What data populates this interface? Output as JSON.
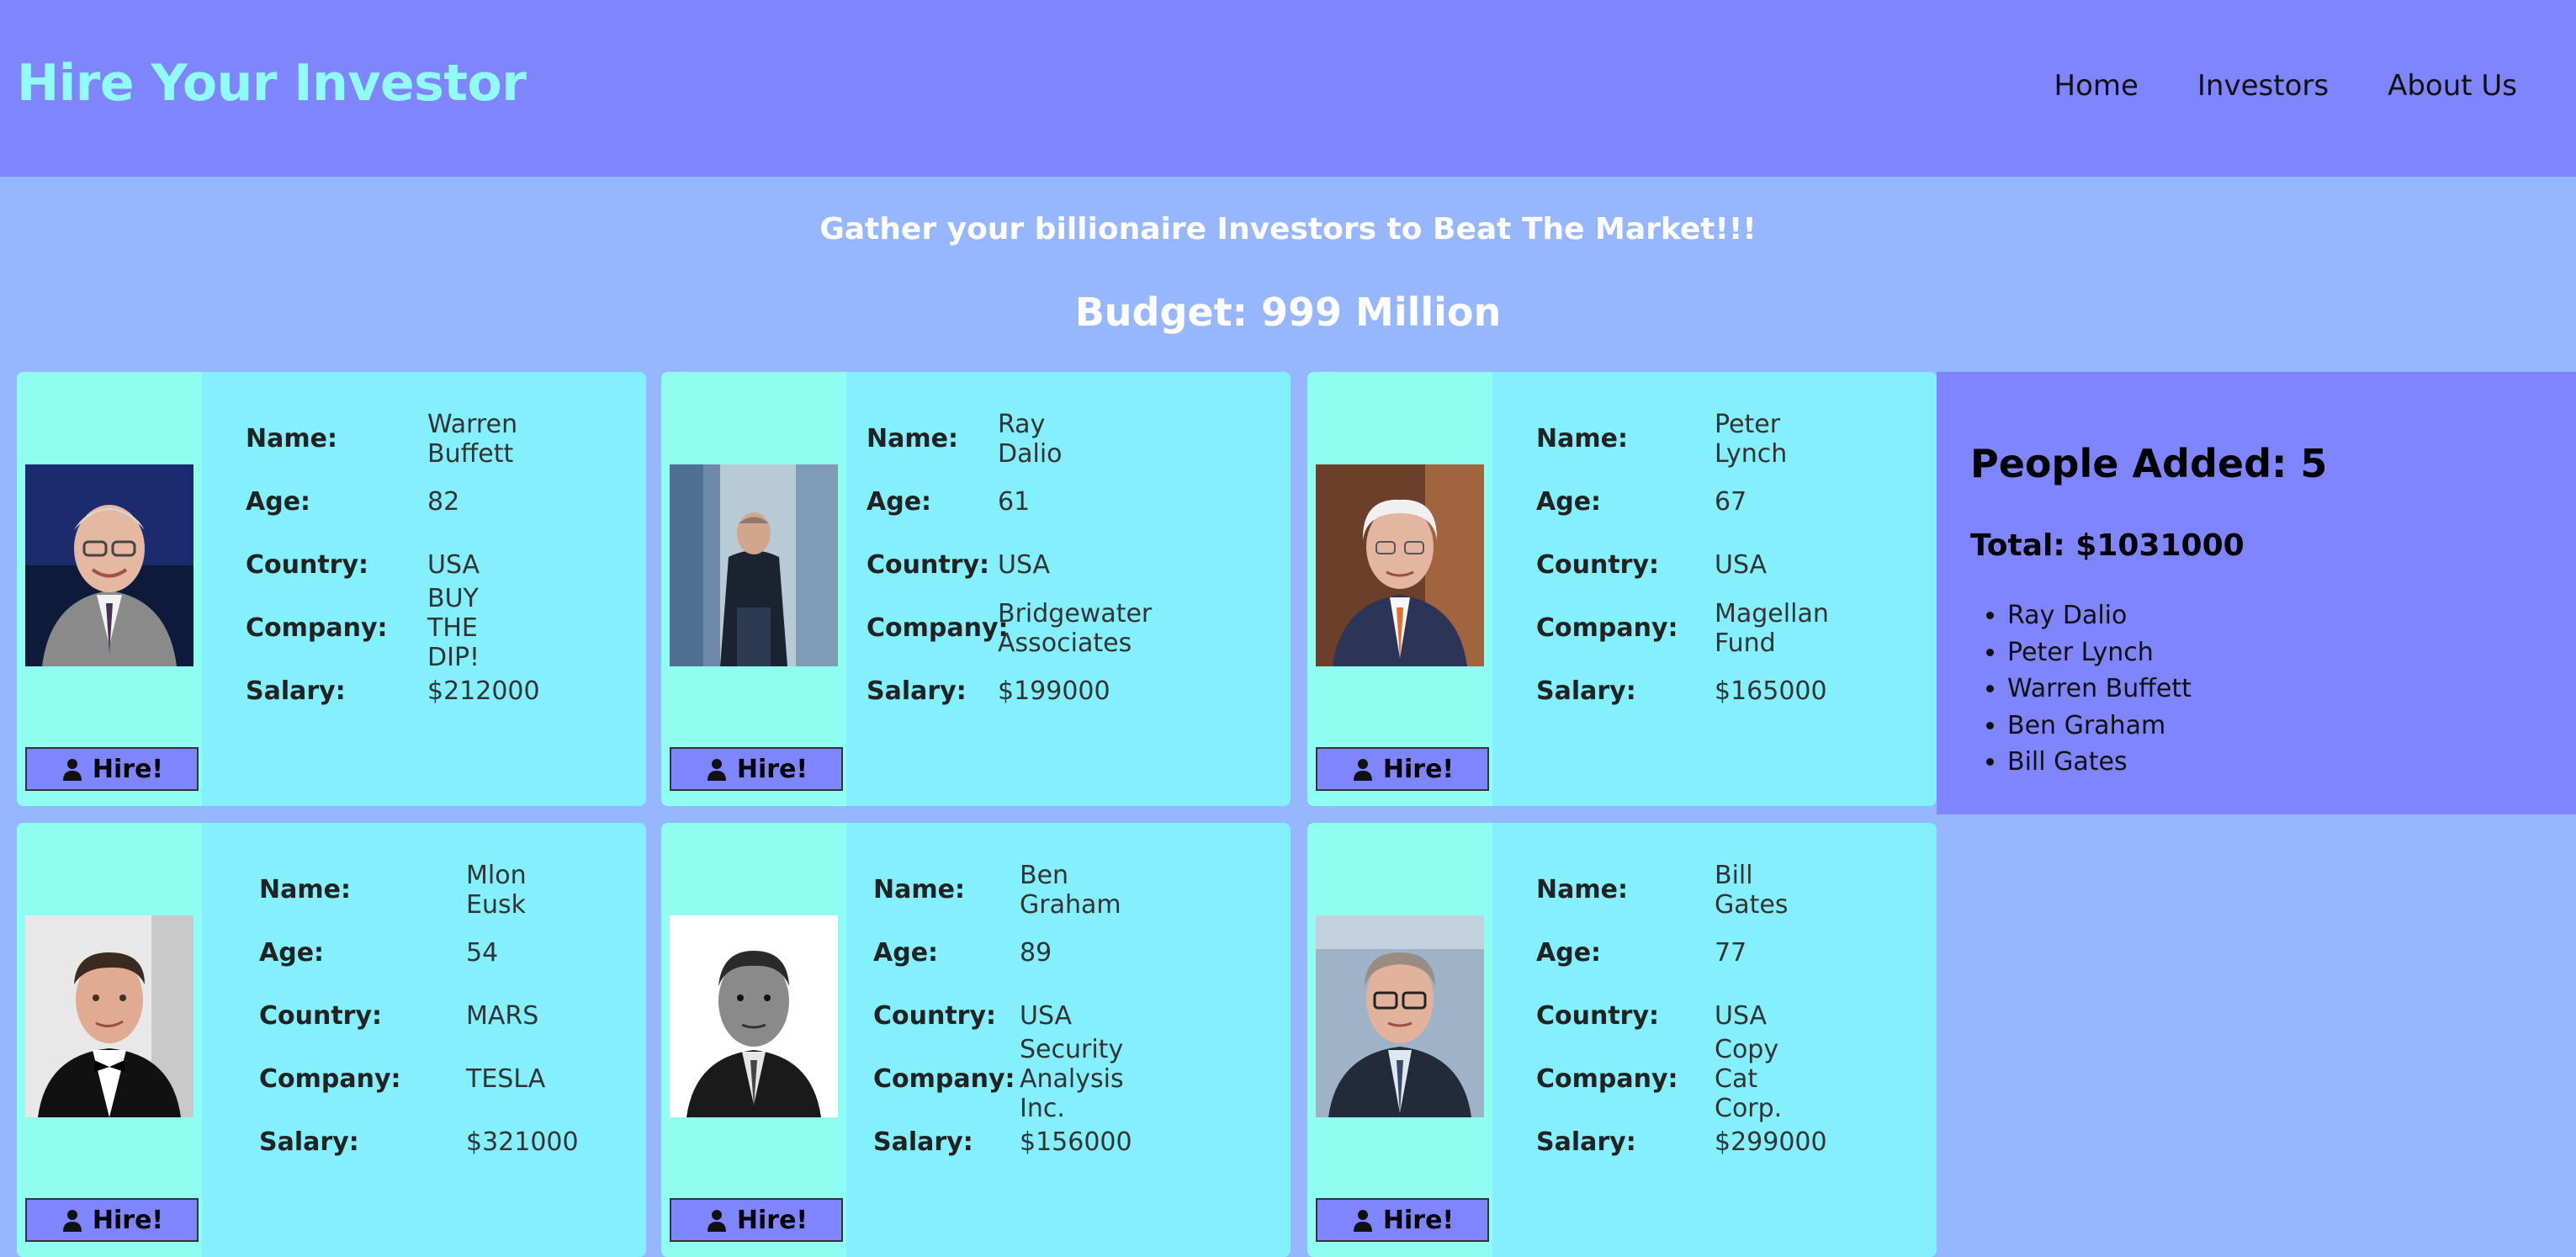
{
  "header": {
    "brand": "Hire Your Investor",
    "nav": [
      "Home",
      "Investors",
      "About Us"
    ]
  },
  "tagline": "Gather your billionaire Investors to Beat The Market!!!",
  "budget": "Budget: 999 Million",
  "labels": {
    "name": "Name:",
    "age": "Age:",
    "country": "Country:",
    "company": "Company:",
    "salary": "Salary:"
  },
  "hire_label": "Hire!",
  "investors": [
    {
      "name": "Warren Buffett",
      "age": "82",
      "country": "USA",
      "company": "BUY THE DIP!",
      "salary": "$212000"
    },
    {
      "name": "Ray Dalio",
      "age": "61",
      "country": "USA",
      "company": "Bridgewater Associates",
      "salary": "$199000"
    },
    {
      "name": "Peter Lynch",
      "age": "67",
      "country": "USA",
      "company": "Magellan Fund",
      "salary": "$165000"
    },
    {
      "name": "Mlon Eusk",
      "age": "54",
      "country": "MARS",
      "company": "TESLA",
      "salary": "$321000"
    },
    {
      "name": "Ben Graham",
      "age": "89",
      "country": "USA",
      "company": "Security Analysis Inc.",
      "salary": "$156000"
    },
    {
      "name": "Bill Gates",
      "age": "77",
      "country": "USA",
      "company": "Copy Cat Corp.",
      "salary": "$299000"
    }
  ],
  "summary": {
    "people_added": "People Added: 5",
    "total": "Total: $1031000",
    "list": [
      "Ray Dalio",
      "Peter Lynch",
      "Warren Buffett",
      "Ben Graham",
      "Bill Gates"
    ]
  },
  "colors": {
    "header_bg": "#7f84ff",
    "brand": "#8ffcf5",
    "page_bg": "#96b7ff",
    "card_bg": "#84f0ff",
    "photo_col": "#8ffdf0",
    "button_bg": "#7f84ff"
  },
  "icons": {
    "hire_button": "user-icon"
  }
}
